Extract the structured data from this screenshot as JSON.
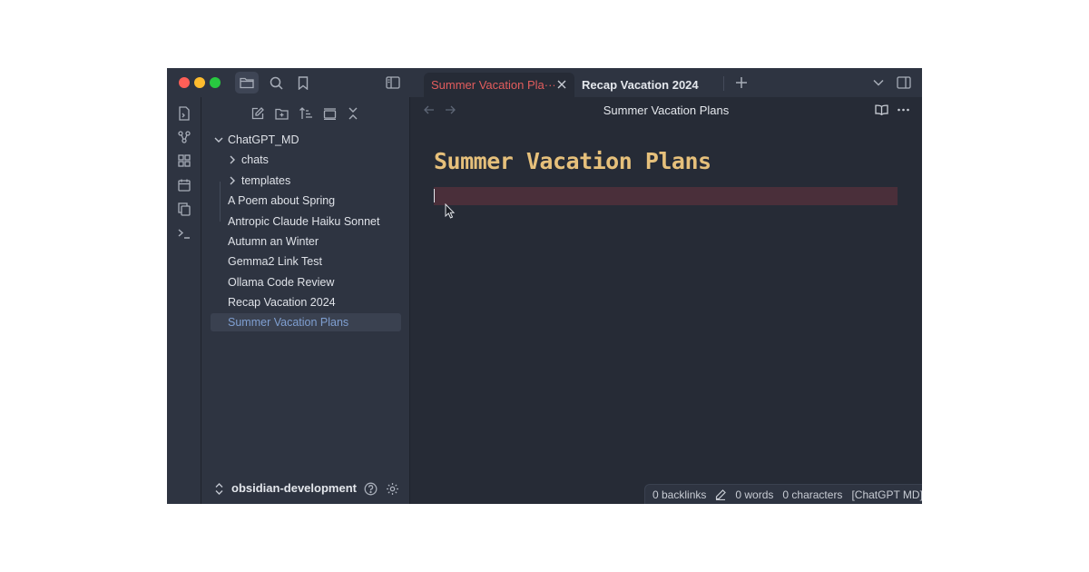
{
  "colors": {
    "accent_tab": "#e35d5d",
    "note_title": "#e6c07b",
    "active_file": "#7f9fd1",
    "background": "#262b36",
    "sidebar": "#2e3441"
  },
  "toolbar": {
    "icons": [
      "folder-icon",
      "search-icon",
      "bookmark-icon",
      "sidebar-toggle-icon"
    ]
  },
  "tabs": [
    {
      "label": "Summer Vacation Pla···",
      "active": true
    },
    {
      "label": "Recap Vacation 2024",
      "active": false
    }
  ],
  "ribbon": {
    "icons": [
      "file-switcher-icon",
      "graph-icon",
      "canvas-icon",
      "calendar-icon",
      "copy-icon",
      "terminal-icon"
    ]
  },
  "sidebar": {
    "toolbar_icons": [
      "new-note-icon",
      "new-folder-icon",
      "sort-icon",
      "collapse-view-icon",
      "collapse-all-icon"
    ],
    "root_folder": "ChatGPT_MD",
    "folders": [
      "chats",
      "templates"
    ],
    "files": [
      "A Poem about Spring",
      "Antropic Claude Haiku Sonnet",
      "Autumn an Winter",
      "Gemma2 Link Test",
      "Ollama Code Review",
      "Recap Vacation 2024",
      "Summer Vacation Plans"
    ],
    "active_file": "Summer Vacation Plans",
    "vault_name": "obsidian-development"
  },
  "editor": {
    "view_title": "Summer Vacation Plans",
    "note_title": "Summer Vacation Plans"
  },
  "status_bar": {
    "backlinks": "0 backlinks",
    "words": "0 words",
    "characters": "0 characters",
    "mode": "[ChatGPT MD]"
  }
}
